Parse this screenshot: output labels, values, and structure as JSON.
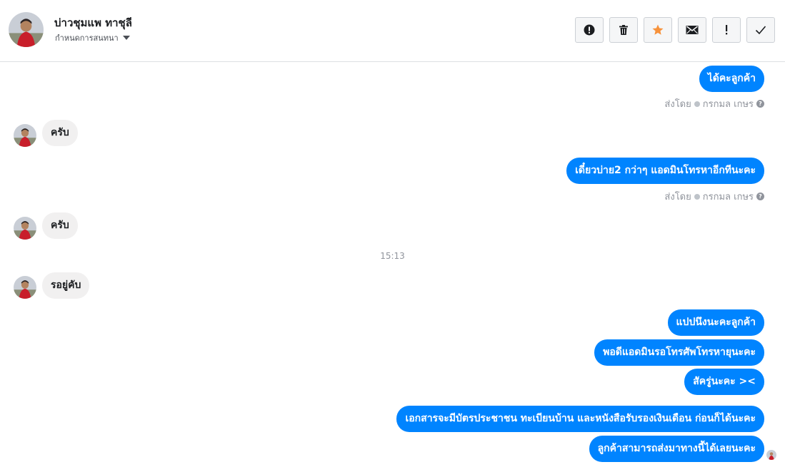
{
  "header": {
    "contact_name": "บ่าวชุมแพ ทาชุลี",
    "conversation_label": "กำหนดการสนทนา",
    "actions": [
      {
        "name": "report-button",
        "icon": "alert-circle-icon",
        "glyph": "!"
      },
      {
        "name": "delete-button",
        "icon": "trash-icon",
        "glyph": ""
      },
      {
        "name": "star-button",
        "icon": "star-icon",
        "glyph": "★"
      },
      {
        "name": "mail-button",
        "icon": "envelope-icon",
        "glyph": ""
      },
      {
        "name": "mark-important-button",
        "icon": "exclamation-icon",
        "glyph": "!"
      },
      {
        "name": "done-button",
        "icon": "check-icon",
        "glyph": "✓"
      }
    ]
  },
  "colors": {
    "outgoing_bubble": "#0084ff",
    "incoming_bubble": "#f1f0f0",
    "star": "#f7923b"
  },
  "messages": {
    "m1": "ได้คะลูกค้า",
    "m2": "ครับ",
    "m3": "เดี๋ยวบ่าย2 กว่าๆ แอดมินโทรหาอีกทีนะคะ",
    "m4": "ครับ",
    "m5": "รอยู่คับ",
    "m6": "แปปนึงนะคะลูกค้า",
    "m7": "พอดีแอดมินรอโทรศัพโทรหายุนะคะ",
    "m8": "สัครู่นะคะ ><",
    "m9": "เอกสารจะมีบัตรประชาชน ทะเบียนบ้าน และหนังสือรับรองเงินเดือน  ก่อนก็ได้นะคะ",
    "m10": "ลูกค้าสามารถส่งมาทางนี้ได้เลยนะคะ"
  },
  "sent_by": {
    "prefix": "ส่งโดย",
    "agent": "กรกมล เกษร",
    "help_glyph": "?"
  },
  "timestamp": "15:13"
}
